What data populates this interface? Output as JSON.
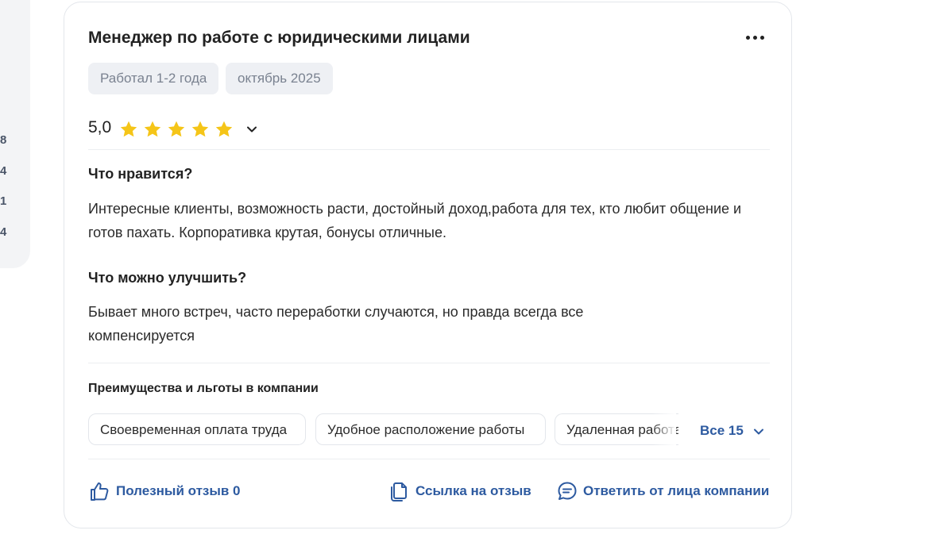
{
  "sidebar": {
    "counts": [
      "8",
      "4",
      "1",
      "4"
    ]
  },
  "review": {
    "title": "Менеджер по работе с юридическими лицами",
    "tags": [
      "Работал 1-2 года",
      "октябрь 2025"
    ],
    "rating": {
      "value": "5,0",
      "stars": 5,
      "max_stars": 5,
      "star_color": "#f5c518"
    },
    "likes_heading": "Что нравится?",
    "likes_text": "Интересные клиенты, возможность расти, достойный доход,работа для тех, кто любит общение и готов пахать. Корпоративка крутая, бонусы отличные.",
    "improve_heading": "Что можно улучшить?",
    "improve_text": "Бывает много встреч, часто переработки случаются, но правда всегда все компенсируется",
    "benefits_heading": "Преимущества и льготы в компании",
    "benefits": [
      "Своевременная оплата труда",
      "Удобное расположение работы",
      "Удаленная работа"
    ],
    "benefits_all_label": "Все 15",
    "actions": {
      "helpful_label": "Полезный отзыв 0",
      "link_label": "Ссылка на отзыв",
      "reply_label": "Ответить от лица компании"
    },
    "accent_color": "#2d5aa0"
  }
}
